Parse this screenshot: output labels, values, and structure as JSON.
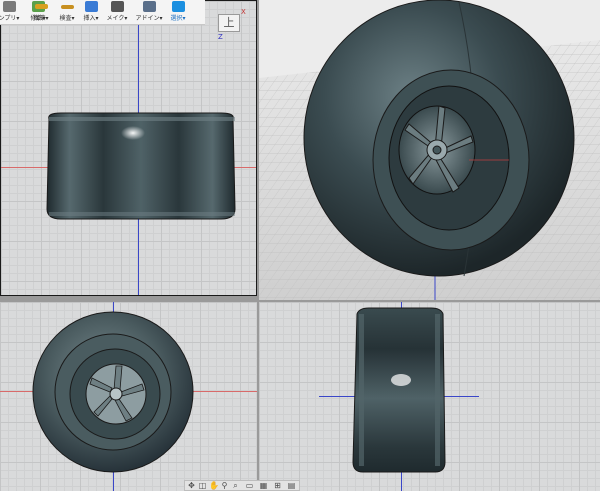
{
  "toolbar": {
    "items": [
      {
        "label": "ンプリ▾",
        "icon": "sculpt-icon",
        "color": "#7a7a7a"
      },
      {
        "label": "修正▾",
        "icon": "modify-icon",
        "color": "#5aa04a"
      },
      {
        "label": "構築▾",
        "icon": "construct-icon",
        "color": "#d8a020"
      },
      {
        "label": "検査▾",
        "icon": "inspect-icon",
        "color": "#c89020"
      },
      {
        "label": "挿入▾",
        "icon": "insert-icon",
        "color": "#3a7bd5"
      },
      {
        "label": "メイク▾",
        "icon": "make-icon",
        "color": "#555555"
      },
      {
        "label": "アドイン▾",
        "icon": "addins-icon",
        "color": "#5a6f8a"
      },
      {
        "label": "選択▾",
        "icon": "select-icon",
        "color": "#1b8fe0"
      }
    ]
  },
  "viewcube": {
    "face_label": "上",
    "x_label": "X",
    "z_label": "Z"
  },
  "colors": {
    "axis_blue": "#3a46c8",
    "axis_red": "#d86a6a",
    "tire": "#42555a"
  }
}
